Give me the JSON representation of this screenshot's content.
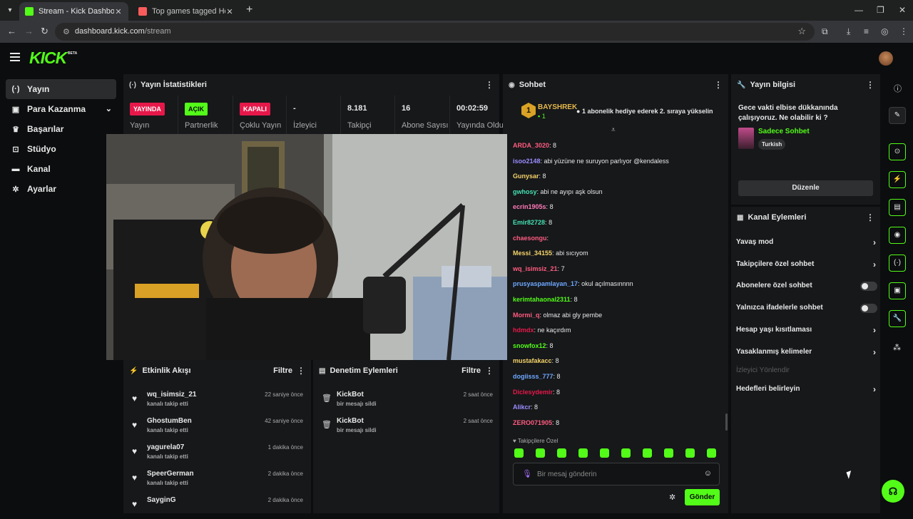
{
  "browser": {
    "tabs": [
      {
        "title": "Stream - Kick Dashboard",
        "favicon_color": "#53fc18"
      },
      {
        "title": "Top games tagged Horror - itch",
        "favicon_color": "#fa5c5c"
      }
    ],
    "url_host": "dashboard.kick.com",
    "url_path": "/stream"
  },
  "kick": {
    "logo": "KICK",
    "beta": "BETA"
  },
  "sidebar": {
    "items": [
      {
        "label": "Yayın",
        "icon": "broadcast-icon"
      },
      {
        "label": "Para Kazanma",
        "icon": "money-icon"
      },
      {
        "label": "Başarılar",
        "icon": "trophy-icon"
      },
      {
        "label": "Stüdyo",
        "icon": "studio-icon"
      },
      {
        "label": "Kanal",
        "icon": "channel-icon"
      },
      {
        "label": "Ayarlar",
        "icon": "gear-icon"
      }
    ]
  },
  "stats": {
    "title": "Yayın İstatistikleri",
    "items": [
      {
        "value": "YAYINDA",
        "label": "Yayın",
        "badge_color": "#e6184a"
      },
      {
        "value": "AÇIK",
        "label": "Partnerlik",
        "badge_color": "#53fc18"
      },
      {
        "value": "KAPALI",
        "label": "Çoklu Yayın",
        "badge_color": "#e6184a"
      },
      {
        "value": "-",
        "label": "İzleyici"
      },
      {
        "value": "8.181",
        "label": "Takipçi"
      },
      {
        "value": "16",
        "label": "Abone Sayısı"
      },
      {
        "value": "00:02:59",
        "label": "Yayında Olduğu"
      }
    ]
  },
  "activity": {
    "title": "Etkinlik Akışı",
    "filter": "Filtre",
    "rows": [
      {
        "name": "wq_isimsiz_21",
        "action": "kanalı takip etti",
        "time": "22 saniye önce"
      },
      {
        "name": "GhostumBen",
        "action": "kanalı takip etti",
        "time": "42 saniye önce"
      },
      {
        "name": "yagurela07",
        "action": "kanalı takip etti",
        "time": "1 dakika önce"
      },
      {
        "name": "SpeerGerman",
        "action": "kanalı takip etti",
        "time": "2 dakika önce"
      },
      {
        "name": "SayginG",
        "action": "",
        "time": "2 dakika önce"
      }
    ]
  },
  "moderation": {
    "title": "Denetim Eylemleri",
    "filter": "Filtre",
    "rows": [
      {
        "name": "KickBot",
        "action": "bir mesajı sildi",
        "time": "2 saat önce"
      },
      {
        "name": "KickBot",
        "action": "bir mesajı sildi",
        "time": "2 saat önce"
      }
    ]
  },
  "chat": {
    "title": "Sohbet",
    "pinned_user": "BAYSHREK",
    "pinned_count": "1",
    "pinned_badge": "1",
    "pinned_text": "1 abonelik hediye ederek 2. sıraya yükselin",
    "messages": [
      {
        "user": "ARDA_3020",
        "color": "#ff5b7f",
        "text": "8"
      },
      {
        "user": "isoo2148",
        "color": "#9b8cff",
        "text": "abi yüzüne ne suruyon parlıyor @kendaless"
      },
      {
        "user": "Gunysar",
        "color": "#f5d36a",
        "text": "8"
      },
      {
        "user": "gwhosy",
        "color": "#45e0b0",
        "text": "abi ne ayıpı aşk olsun"
      },
      {
        "user": "ecrin1905s",
        "color": "#ff7ab8",
        "text": "8"
      },
      {
        "user": "Emir82728",
        "color": "#45e0b0",
        "text": "8"
      },
      {
        "user": "chaesongu",
        "color": "#ff5b7f",
        "text": ""
      },
      {
        "user": "Messi_34155",
        "color": "#f5d36a",
        "text": "abi sıcıyom"
      },
      {
        "user": "wq_isimsiz_21",
        "color": "#ff5b7f",
        "text": "7"
      },
      {
        "user": "prusyaspamlayan_17",
        "color": "#6fa8ff",
        "text": "okul açılmasınnnn"
      },
      {
        "user": "kerimtahaonal2311",
        "color": "#53fc18",
        "text": "8"
      },
      {
        "user": "Mormi_q",
        "color": "#ff5b7f",
        "text": "olmaz abi gly pembe"
      },
      {
        "user": "hdmdx",
        "color": "#e6184a",
        "text": "ne kaçırdım"
      },
      {
        "user": "snowfox12",
        "color": "#53fc18",
        "text": "8"
      },
      {
        "user": "mustafakacc",
        "color": "#f5d36a",
        "text": "8"
      },
      {
        "user": "dogiisss_777",
        "color": "#6fa8ff",
        "text": "8"
      },
      {
        "user": "Diclesydemir",
        "color": "#e6184a",
        "text": "8"
      },
      {
        "user": "Alikcr",
        "color": "#9b8cff",
        "text": "8"
      },
      {
        "user": "ZERO071905",
        "color": "#ff5b7f",
        "text": "8"
      }
    ],
    "followers_only": "Takipçilere Özel",
    "input_placeholder": "Bir mesaj gönderin",
    "send": "Gönder"
  },
  "stream_info": {
    "title": "Yayın bilgisi",
    "stream_title": "Gece vakti elbise dükkanında çalışıyoruz. Ne olabilir ki ?",
    "category": "Sadece Sohbet",
    "language": "Turkish",
    "edit": "Düzenle"
  },
  "channel_actions": {
    "title": "Kanal Eylemleri",
    "rows": [
      {
        "label": "Yavaş mod",
        "type": "chevron"
      },
      {
        "label": "Takipçilere özel sohbet",
        "type": "chevron"
      },
      {
        "label": "Abonelere özel sohbet",
        "type": "toggle"
      },
      {
        "label": "Yalnızca ifadelerle sohbet",
        "type": "toggle"
      },
      {
        "label": "Hesap yaşı kısıtlaması",
        "type": "chevron"
      },
      {
        "label": "Yasaklanmış kelimeler",
        "type": "chevron"
      },
      {
        "label": "İzleyici Yönlendir",
        "type": "disabled"
      },
      {
        "label": "Hedefleri belirleyin",
        "type": "chevron"
      }
    ]
  },
  "colors": {
    "brand": "#53fc18",
    "live_red": "#e6184a"
  }
}
